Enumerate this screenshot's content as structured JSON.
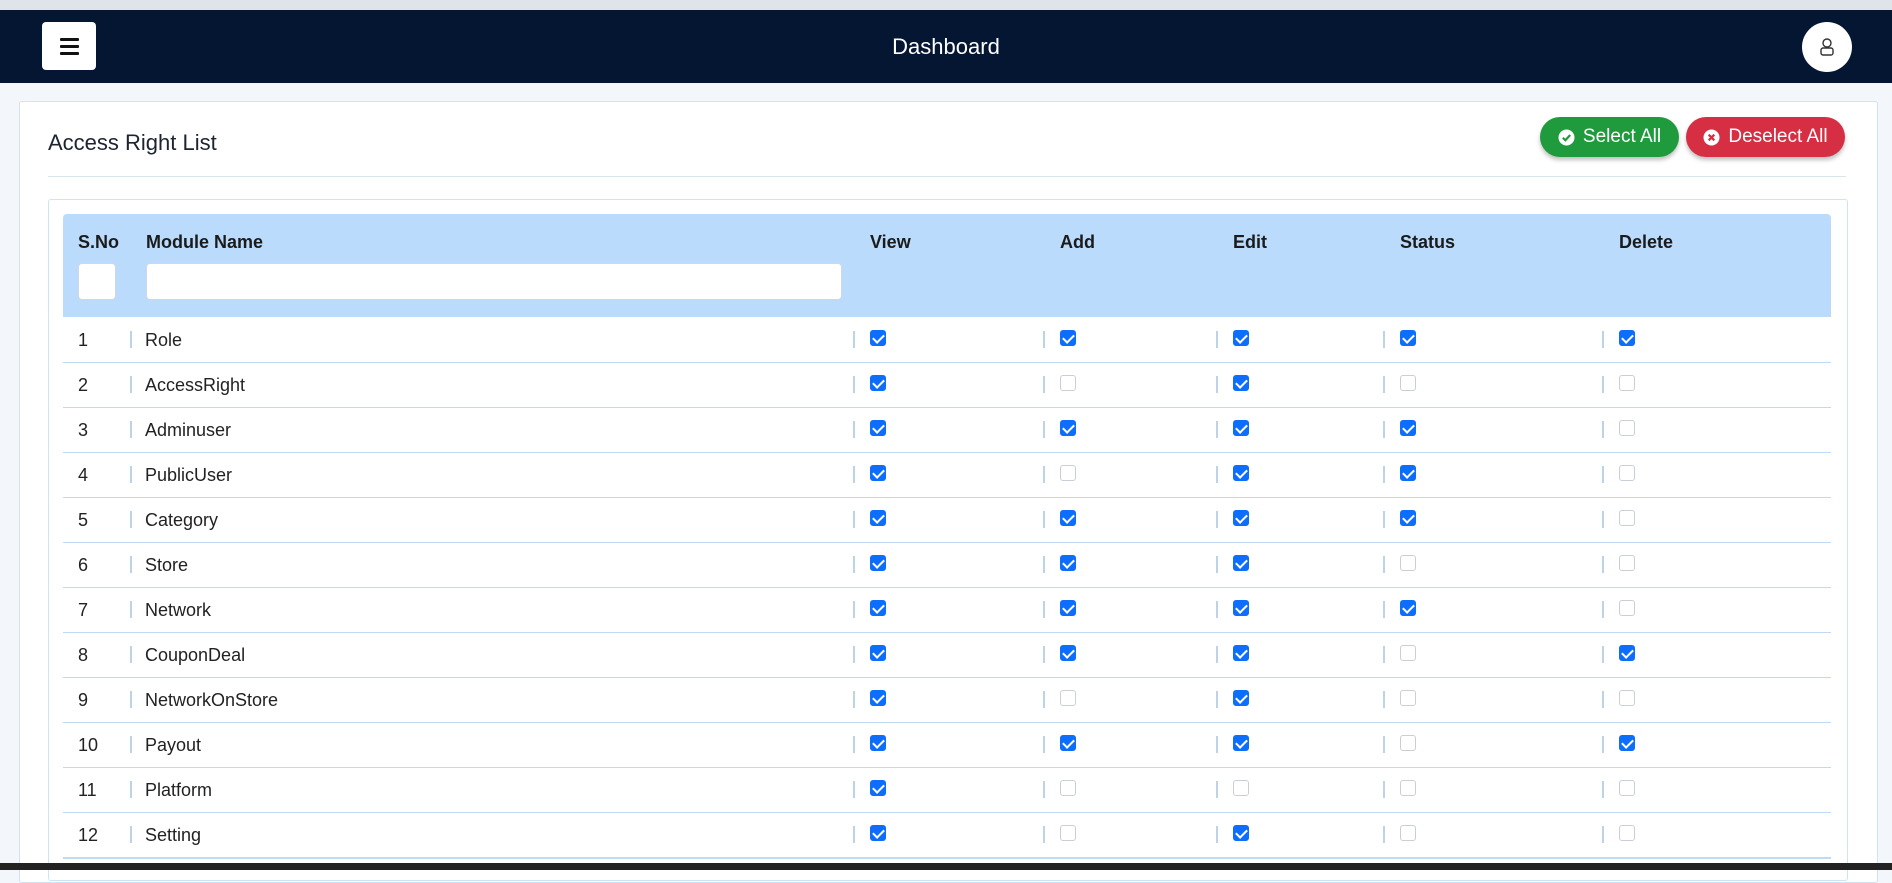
{
  "navbar": {
    "title": "Dashboard",
    "menu_icon": "hamburger-icon",
    "user_icon": "user-icon"
  },
  "card": {
    "title": "Access Right List",
    "select_all_label": "Select All",
    "deselect_all_label": "Deselect All",
    "select_all_icon": "check-circle-icon",
    "deselect_all_icon": "x-circle-icon"
  },
  "colors": {
    "navbar": "#051633",
    "header_row": "#badbfb",
    "select_all": "#1f9a3c",
    "deselect_all": "#d62e43",
    "checkbox_on": "#0d6efd"
  },
  "table": {
    "columns": [
      "S.No",
      "Module Name",
      "View",
      "Add",
      "Edit",
      "Status",
      "Delete"
    ],
    "rows": [
      {
        "sno": "1",
        "name": "Role",
        "perms": [
          true,
          true,
          true,
          true,
          true
        ]
      },
      {
        "sno": "2",
        "name": "AccessRight",
        "perms": [
          true,
          false,
          true,
          false,
          false
        ]
      },
      {
        "sno": "3",
        "name": "Adminuser",
        "perms": [
          true,
          true,
          true,
          true,
          false
        ]
      },
      {
        "sno": "4",
        "name": "PublicUser",
        "perms": [
          true,
          false,
          true,
          true,
          false
        ]
      },
      {
        "sno": "5",
        "name": "Category",
        "perms": [
          true,
          true,
          true,
          true,
          false
        ]
      },
      {
        "sno": "6",
        "name": "Store",
        "perms": [
          true,
          true,
          true,
          false,
          false
        ]
      },
      {
        "sno": "7",
        "name": "Network",
        "perms": [
          true,
          true,
          true,
          true,
          false
        ]
      },
      {
        "sno": "8",
        "name": "CouponDeal",
        "perms": [
          true,
          true,
          true,
          false,
          true
        ]
      },
      {
        "sno": "9",
        "name": "NetworkOnStore",
        "perms": [
          true,
          false,
          true,
          false,
          false
        ]
      },
      {
        "sno": "10",
        "name": "Payout",
        "perms": [
          true,
          true,
          true,
          false,
          true
        ]
      },
      {
        "sno": "11",
        "name": "Platform",
        "perms": [
          true,
          false,
          false,
          false,
          false
        ]
      },
      {
        "sno": "12",
        "name": "Setting",
        "perms": [
          true,
          false,
          true,
          false,
          false
        ]
      }
    ]
  }
}
